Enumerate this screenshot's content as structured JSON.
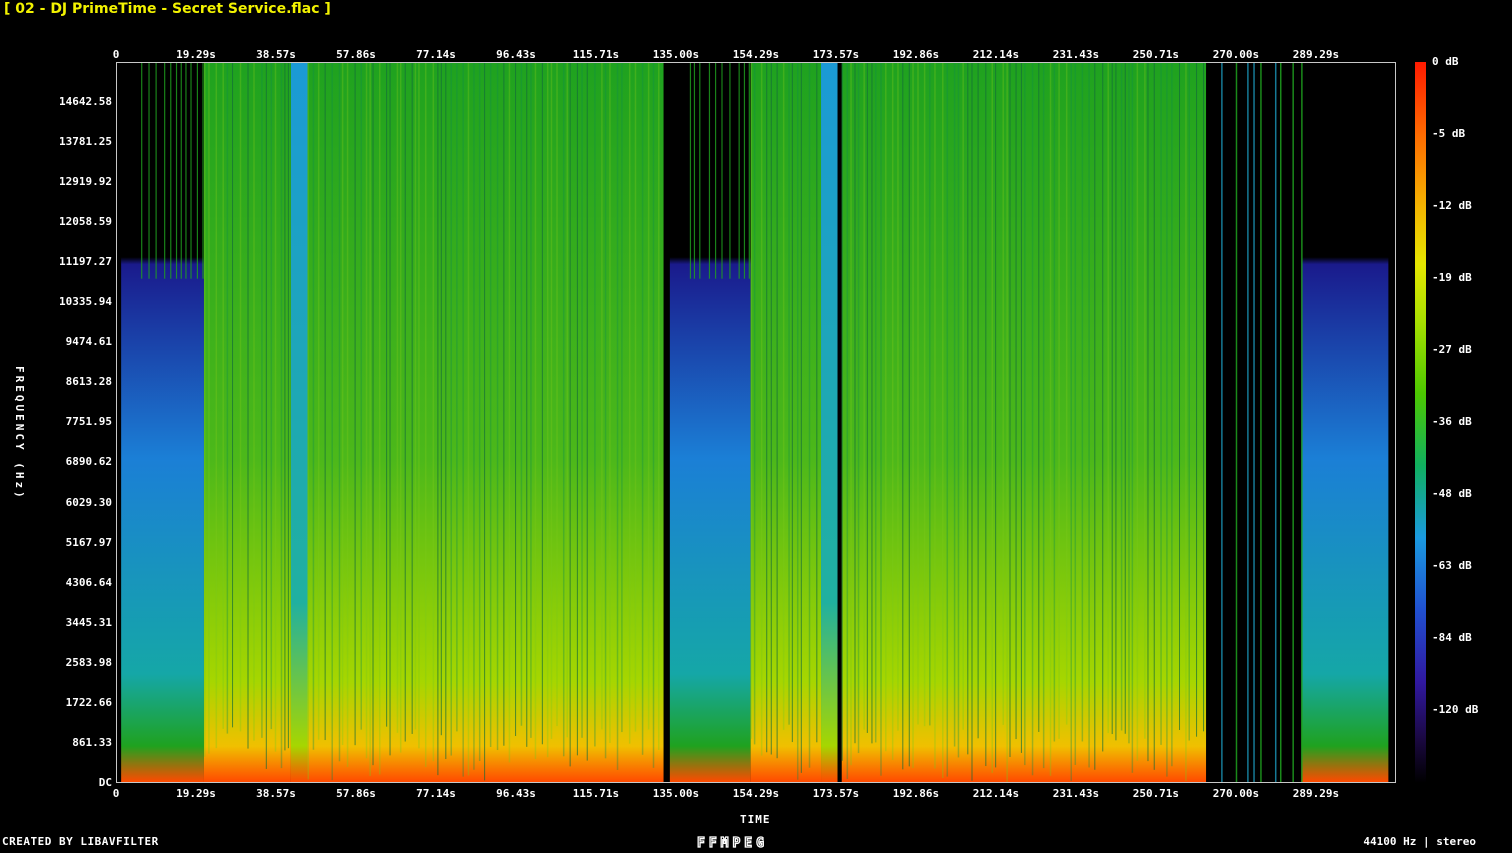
{
  "title": "[ 02 - DJ PrimeTime - Secret Service.flac ]",
  "footer": {
    "left": "CREATED BY LIBAVFILTER",
    "logo": "FFMPEG",
    "right": "44100 Hz | stereo"
  },
  "chart_data": {
    "type": "heatmap",
    "xlabel": "TIME",
    "ylabel": "FREQUENCY (Hz)",
    "x_ticks": [
      "0",
      "19.29s",
      "38.57s",
      "57.86s",
      "77.14s",
      "96.43s",
      "115.71s",
      "135.00s",
      "154.29s",
      "173.57s",
      "192.86s",
      "212.14s",
      "231.43s",
      "250.71s",
      "270.00s",
      "289.29s"
    ],
    "x_tick_values": [
      0,
      19.29,
      38.57,
      57.86,
      77.14,
      96.43,
      115.71,
      135.0,
      154.29,
      173.57,
      192.86,
      212.14,
      231.43,
      250.71,
      270.0,
      289.29
    ],
    "xlim": [
      0,
      308.6
    ],
    "y_ticks": [
      "DC",
      "861.33",
      "1722.66",
      "2583.98",
      "3445.31",
      "4306.64",
      "5167.97",
      "6029.30",
      "6890.62",
      "7751.95",
      "8613.28",
      "9474.61",
      "10335.94",
      "11197.27",
      "12058.59",
      "12919.92",
      "13781.25",
      "14642.58"
    ],
    "y_tick_values": [
      0,
      861.33,
      1722.66,
      2583.98,
      3445.31,
      4306.64,
      5167.97,
      6029.3,
      6890.62,
      7751.95,
      8613.28,
      9474.61,
      10335.94,
      11197.27,
      12058.59,
      12919.92,
      13781.25,
      14642.58
    ],
    "ylim": [
      0,
      15500
    ],
    "colorbar_labels": [
      "0 dB",
      "-5 dB",
      "-12 dB",
      "-19 dB",
      "-27 dB",
      "-36 dB",
      "-48 dB",
      "-63 dB",
      "-84 dB",
      "-120 dB"
    ],
    "sample_rate_hz": 44100,
    "channels": "stereo",
    "segments": [
      {
        "start": 0,
        "end": 1,
        "level": "silence"
      },
      {
        "start": 1,
        "end": 21,
        "level": "quiet-intro",
        "cutoff_hz": 11300
      },
      {
        "start": 21,
        "end": 42,
        "level": "loud"
      },
      {
        "start": 42,
        "end": 46,
        "level": "breakdown"
      },
      {
        "start": 46,
        "end": 132,
        "level": "loud"
      },
      {
        "start": 132,
        "end": 133.5,
        "level": "silence"
      },
      {
        "start": 133.5,
        "end": 153,
        "level": "quiet-intro",
        "cutoff_hz": 11300
      },
      {
        "start": 153,
        "end": 170,
        "level": "loud"
      },
      {
        "start": 170,
        "end": 174,
        "level": "breakdown"
      },
      {
        "start": 174,
        "end": 175,
        "level": "silence"
      },
      {
        "start": 175,
        "end": 263,
        "level": "loud"
      },
      {
        "start": 263,
        "end": 286,
        "level": "silence-gaps"
      },
      {
        "start": 286,
        "end": 307,
        "level": "quiet-outro",
        "cutoff_hz": 11300
      }
    ],
    "colors": {
      "loud_high": "#1fa21f",
      "loud_mid": "#4cb81a",
      "loud_low": "#a6d600",
      "bass": "#f0c000",
      "sub_bass": "#ff4a00",
      "quiet_high": "#1a1a8c",
      "quiet_mid": "#1b7fd6",
      "quiet_low": "#15a7a7"
    }
  }
}
